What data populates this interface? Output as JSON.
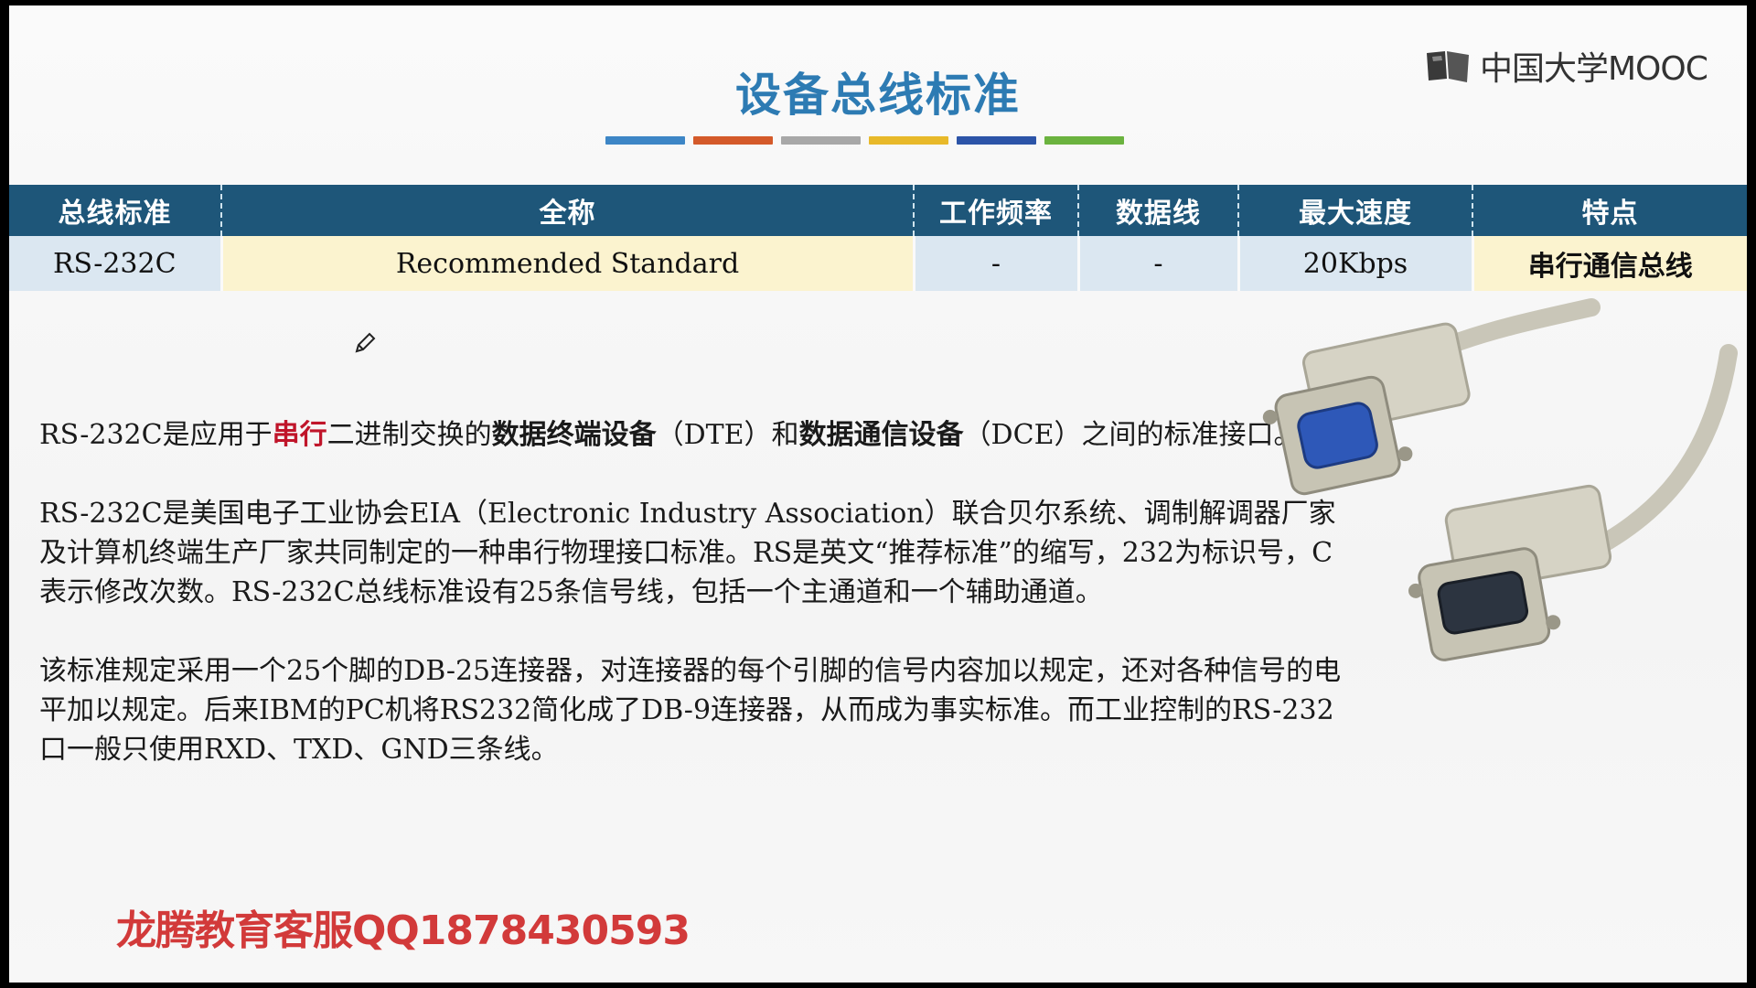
{
  "slide": {
    "title": "设备总线标准",
    "title_color": "#2d7bb3",
    "color_bars": [
      "#3d86c6",
      "#d45a2a",
      "#a8a8a8",
      "#e8b92a",
      "#2c54a8",
      "#6bb33f"
    ]
  },
  "logo": {
    "text": "中国大学MOOC",
    "icon": "book-icon"
  },
  "table": {
    "headers": [
      "总线标准",
      "全称",
      "工作频率",
      "数据线",
      "最大速度",
      "特点"
    ],
    "row": {
      "bus": "RS-232C",
      "full_name": "Recommended Standard",
      "frequency": "-",
      "data_lines": "-",
      "max_speed": "20Kbps",
      "feature": "串行通信总线"
    },
    "header_color": "#1e5679"
  },
  "paragraphs": {
    "p1": {
      "before": "RS-232C是应用于",
      "highlight": "串行",
      "middle": "二进制交换的",
      "bold1": "数据终端设备",
      "mid2": "（DTE）和",
      "bold2": "数据通信设备",
      "after": "（DCE）之间的标准接口。"
    },
    "p2": "RS-232C是美国电子工业协会EIA（Electronic Industry Association）联合贝尔系统、调制解调器厂家及计算机终端生产厂家共同制定的一种串行物理接口标准。RS是英文“推荐标准”的缩写，232为标识号，C表示修改次数。RS-232C总线标准设有25条信号线，包括一个主通道和一个辅助通道。",
    "p3": "该标准规定采用一个25个脚的DB-25连接器，对连接器的每个引脚的信号内容加以规定，还对各种信号的电平加以规定。后来IBM的PC机将RS232简化成了DB-9连接器，从而成为事实标准。而工业控制的RS-232口一般只使用RXD、TXD、GND三条线。"
  },
  "watermark": "龙腾教育客服QQ1878430593",
  "icons": {
    "pencil": "pencil-cursor-icon",
    "photo": "serial-cable-image"
  }
}
